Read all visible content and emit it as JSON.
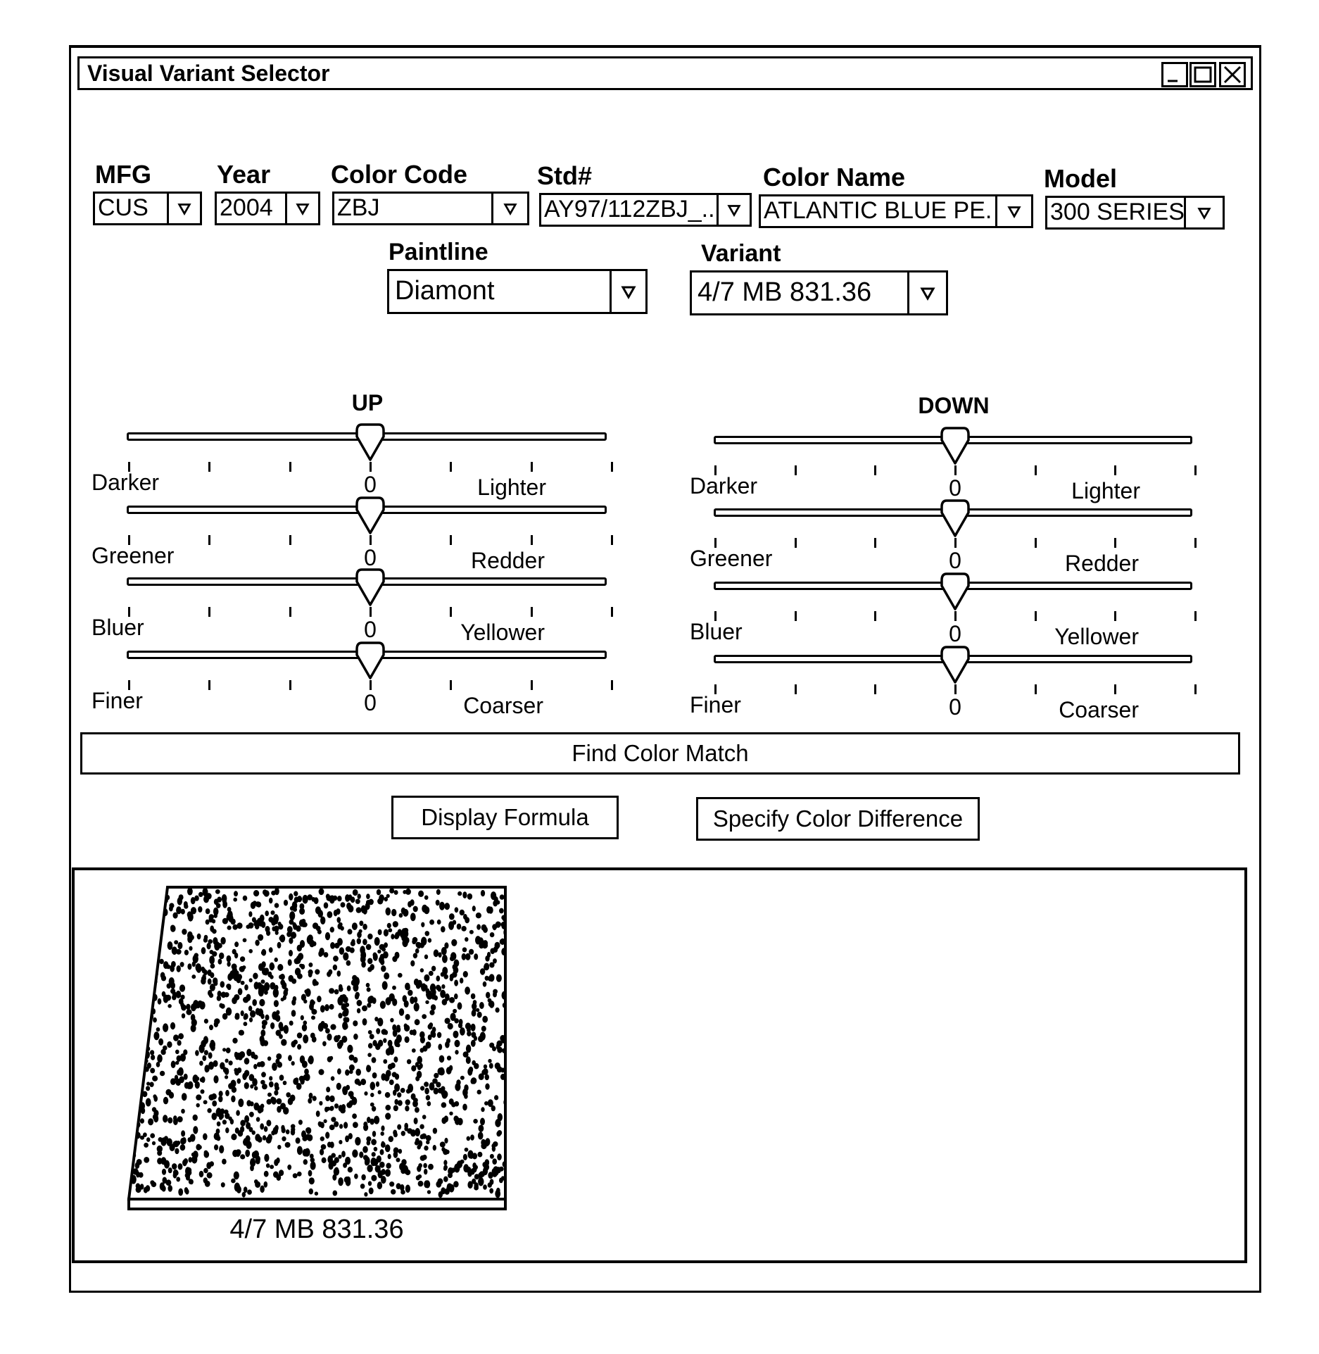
{
  "window": {
    "title": "Visual Variant Selector",
    "controls": [
      {
        "name": "minimize",
        "icon": "minimize-icon"
      },
      {
        "name": "maximize",
        "icon": "maximize-icon"
      },
      {
        "name": "close",
        "icon": "close-icon"
      }
    ]
  },
  "filters": [
    {
      "label": "MFG",
      "value": "CUS"
    },
    {
      "label": "Year",
      "value": "2004"
    },
    {
      "label": "Color Code",
      "value": "ZBJ"
    },
    {
      "label": "Std#",
      "value": "AY97/112ZBJ_.."
    },
    {
      "label": "Color Name",
      "value": "ATLANTIC BLUE PE."
    },
    {
      "label": "Model",
      "value": "300 SERIES"
    }
  ],
  "paintline": {
    "label": "Paintline",
    "value": "Diamont"
  },
  "variant": {
    "label": "Variant",
    "value": "4/7 MB 831.36"
  },
  "adjustments": {
    "up": {
      "heading": "UP",
      "sliders": [
        {
          "left": "Darker",
          "right": "Lighter",
          "center": "0",
          "value": 0,
          "min": -3,
          "max": 3
        },
        {
          "left": "Greener",
          "right": "Redder",
          "center": "0",
          "value": 0,
          "min": -3,
          "max": 3
        },
        {
          "left": "Bluer",
          "right": "Yellower",
          "center": "0",
          "value": 0,
          "min": -3,
          "max": 3
        },
        {
          "left": "Finer",
          "right": "Coarser",
          "center": "0",
          "value": 0,
          "min": -3,
          "max": 3
        }
      ]
    },
    "down": {
      "heading": "DOWN",
      "sliders": [
        {
          "left": "Darker",
          "right": "Lighter",
          "center": "0",
          "value": 0,
          "min": -3,
          "max": 3
        },
        {
          "left": "Greener",
          "right": "Redder",
          "center": "0",
          "value": 0,
          "min": -3,
          "max": 3
        },
        {
          "left": "Bluer",
          "right": "Yellower",
          "center": "0",
          "value": 0,
          "min": -3,
          "max": 3
        },
        {
          "left": "Finer",
          "right": "Coarser",
          "center": "0",
          "value": 0,
          "min": -3,
          "max": 3
        }
      ]
    }
  },
  "actions": {
    "find_match": "Find Color Match",
    "display_formula": "Display Formula",
    "specify_difference": "Specify Color Difference"
  },
  "preview": {
    "swatch_caption": "4/7 MB 831.36",
    "swatch_texture": "metallic-flake"
  },
  "icons": {
    "dropdown": "chevron-down-icon"
  }
}
